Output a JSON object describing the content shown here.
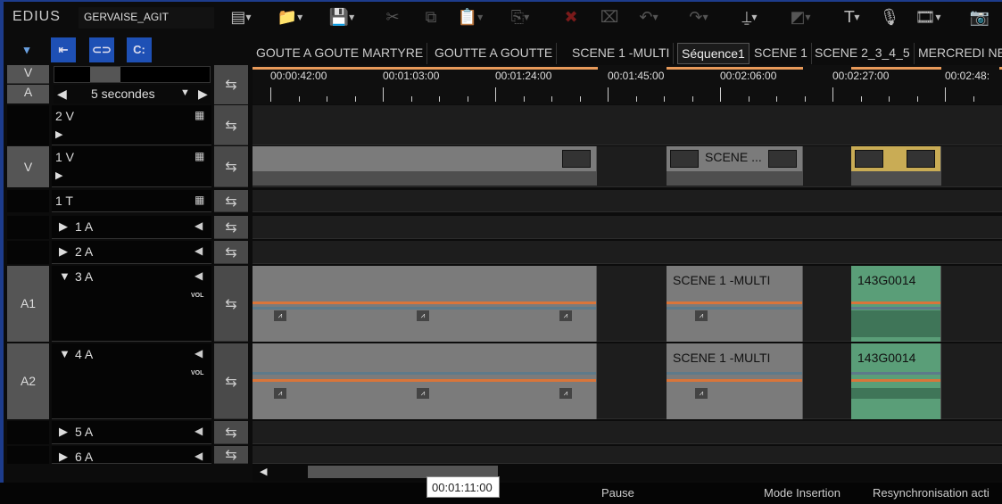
{
  "app": {
    "logo": "EDIUS",
    "project": "GERVAISE_AGIT"
  },
  "toolbar": [
    {
      "icon": "new-sequence-icon",
      "glyph": "▤",
      "dd": true,
      "enabled": true
    },
    {
      "icon": "open-folder-icon",
      "glyph": "📁",
      "dd": true,
      "enabled": true
    },
    {
      "icon": "save-icon",
      "glyph": "💾",
      "dd": true,
      "enabled": true
    },
    {
      "icon": "cut-icon",
      "glyph": "✂",
      "dd": false,
      "enabled": false
    },
    {
      "icon": "copy-icon",
      "glyph": "⧉",
      "dd": false,
      "enabled": false
    },
    {
      "icon": "paste-icon",
      "glyph": "📋",
      "dd": true,
      "enabled": false
    },
    {
      "icon": "replace-icon",
      "glyph": "⎘",
      "dd": true,
      "enabled": false
    },
    {
      "icon": "delete-icon",
      "glyph": "✖",
      "dd": false,
      "enabled": false
    },
    {
      "icon": "ripple-delete-icon",
      "glyph": "⌧",
      "dd": false,
      "enabled": false
    },
    {
      "icon": "undo-icon",
      "glyph": "↶",
      "dd": true,
      "enabled": false
    },
    {
      "icon": "redo-icon",
      "glyph": "↷",
      "dd": true,
      "enabled": false
    },
    {
      "icon": "marker-icon",
      "glyph": "⍊",
      "dd": true,
      "enabled": true
    },
    {
      "icon": "transition-icon",
      "glyph": "◩",
      "dd": true,
      "enabled": false
    },
    {
      "icon": "title-icon",
      "glyph": "T",
      "dd": true,
      "enabled": true
    },
    {
      "icon": "voiceover-icon",
      "glyph": "🎙",
      "dd": false,
      "enabled": true
    },
    {
      "icon": "render-icon",
      "glyph": "🎞",
      "dd": true,
      "enabled": true
    },
    {
      "icon": "snapshot-icon",
      "glyph": "📷",
      "dd": false,
      "enabled": true
    }
  ],
  "modes": [
    {
      "icon": "track-mode-icon",
      "glyph": "▾"
    },
    {
      "icon": "insert-mode-icon",
      "glyph": "⇤"
    },
    {
      "icon": "link-icon",
      "glyph": "⊂⊃"
    },
    {
      "icon": "group-icon",
      "glyph": "C:"
    }
  ],
  "tabs": [
    {
      "label": "GOUTE A GOUTE MARTYRE"
    },
    {
      "label": "GOUTTE  A GOUTTE"
    },
    {
      "label": "SCENE 1 -MULTI"
    },
    {
      "label": "Séquence1",
      "active": true
    },
    {
      "label": "SCENE 1"
    },
    {
      "label": "SCENE 2_3_4_5"
    },
    {
      "label": "MERCREDI NE"
    }
  ],
  "scale": {
    "v": "V",
    "a": "A",
    "value": "5 secondes"
  },
  "ruler": [
    "00:00:42:00",
    "00:01:03:00",
    "00:01:24:00",
    "00:01:45:00",
    "00:02:06:00",
    "00:02:27:00",
    "00:02:48:"
  ],
  "tracks": [
    {
      "name": "2 V",
      "type": "video",
      "patch": ""
    },
    {
      "name": "1 V",
      "type": "video",
      "patch": "V"
    },
    {
      "name": "1 T",
      "type": "title",
      "patch": ""
    },
    {
      "name": "1 A",
      "type": "audio",
      "patch": ""
    },
    {
      "name": "2 A",
      "type": "audio",
      "patch": ""
    },
    {
      "name": "3 A",
      "type": "audio",
      "patch": "A1",
      "expanded": true,
      "vol": "VOL"
    },
    {
      "name": "4 A",
      "type": "audio",
      "patch": "A2",
      "expanded": true,
      "vol": "VOL"
    },
    {
      "name": "5 A",
      "type": "audio",
      "patch": ""
    },
    {
      "name": "6 A",
      "type": "audio",
      "patch": ""
    }
  ],
  "clips": {
    "video_mid": "SCENE ...",
    "audio": [
      "SCENE 1 -MULTI",
      "143G0014"
    ]
  },
  "status": {
    "timecode": "00:01:11:00",
    "state": "Pause",
    "mode": "Mode Insertion",
    "resync": "Resynchronisation acti"
  }
}
